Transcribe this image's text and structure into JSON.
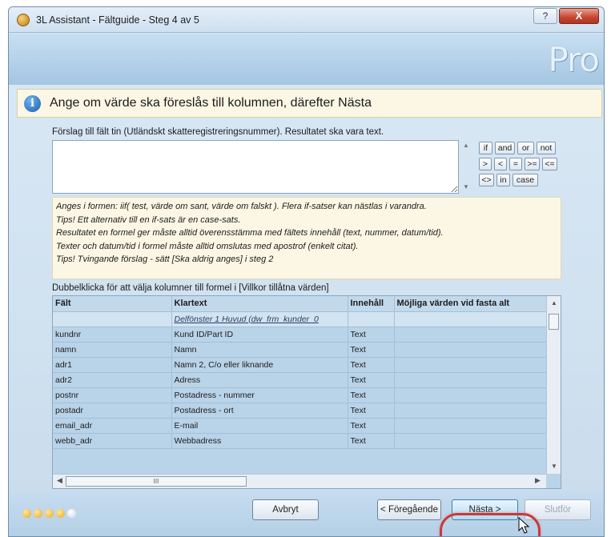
{
  "window": {
    "title": "3L Assistant - Fältguide - Steg 4 av 5",
    "help_label": "?",
    "close_label": "X",
    "logo_text": "Pro"
  },
  "banner": {
    "text": "Ange om värde ska föreslås till kolumnen, därefter Nästa"
  },
  "formula": {
    "field_label": "Förslag till fält tin (Utländskt skatteregistreringsnummer). Resultatet ska vara text.",
    "value": "",
    "operators": [
      "if",
      "and",
      "or",
      "not",
      ">",
      "<",
      "=",
      ">=",
      "<=",
      "<>",
      "in",
      "case"
    ]
  },
  "help_lines": [
    "Anges i formen: iif( test, värde om sant, värde om falskt ). Flera if-satser kan nästlas i varandra.",
    "Tips! Ett alternativ till en if-sats är en case-sats.",
    "Resultatet en formel ger måste alltid överensstämma med fältets innehåll (text, nummer, datum/tid).",
    "Texter och datum/tid i formel måste alltid omslutas med apostrof (enkelt citat).",
    "Tips! Tvingande förslag - sätt [Ska aldrig anges] i steg 2"
  ],
  "columns_label": "Dubbelklicka för att välja kolumner till formel i [Villkor tillåtna värden]",
  "grid": {
    "headers": [
      "Fält",
      "Klartext",
      "Innehåll",
      "Möjliga värden vid fasta alt"
    ],
    "subheader": "Delfönster 1 Huvud (dw_frm_kunder_0",
    "rows": [
      [
        "kundnr",
        "Kund ID/Part ID",
        "Text",
        ""
      ],
      [
        "namn",
        "Namn",
        "Text",
        ""
      ],
      [
        "adr1",
        "Namn 2, C/o eller liknande",
        "Text",
        ""
      ],
      [
        "adr2",
        "Adress",
        "Text",
        ""
      ],
      [
        "postnr",
        "Postadress - nummer",
        "Text",
        ""
      ],
      [
        "postadr",
        "Postadress - ort",
        "Text",
        ""
      ],
      [
        "email_adr",
        "E-mail",
        "Text",
        ""
      ],
      [
        "webb_adr",
        "Webbadress",
        "Text",
        ""
      ]
    ],
    "hscroll_grip": "III"
  },
  "footer": {
    "progress_steps_total": 5,
    "progress_steps_done": 4,
    "cancel_label": "Avbryt",
    "prev_label": "< Föregående",
    "next_label": "Nästa >",
    "finish_label": "Slutför"
  }
}
